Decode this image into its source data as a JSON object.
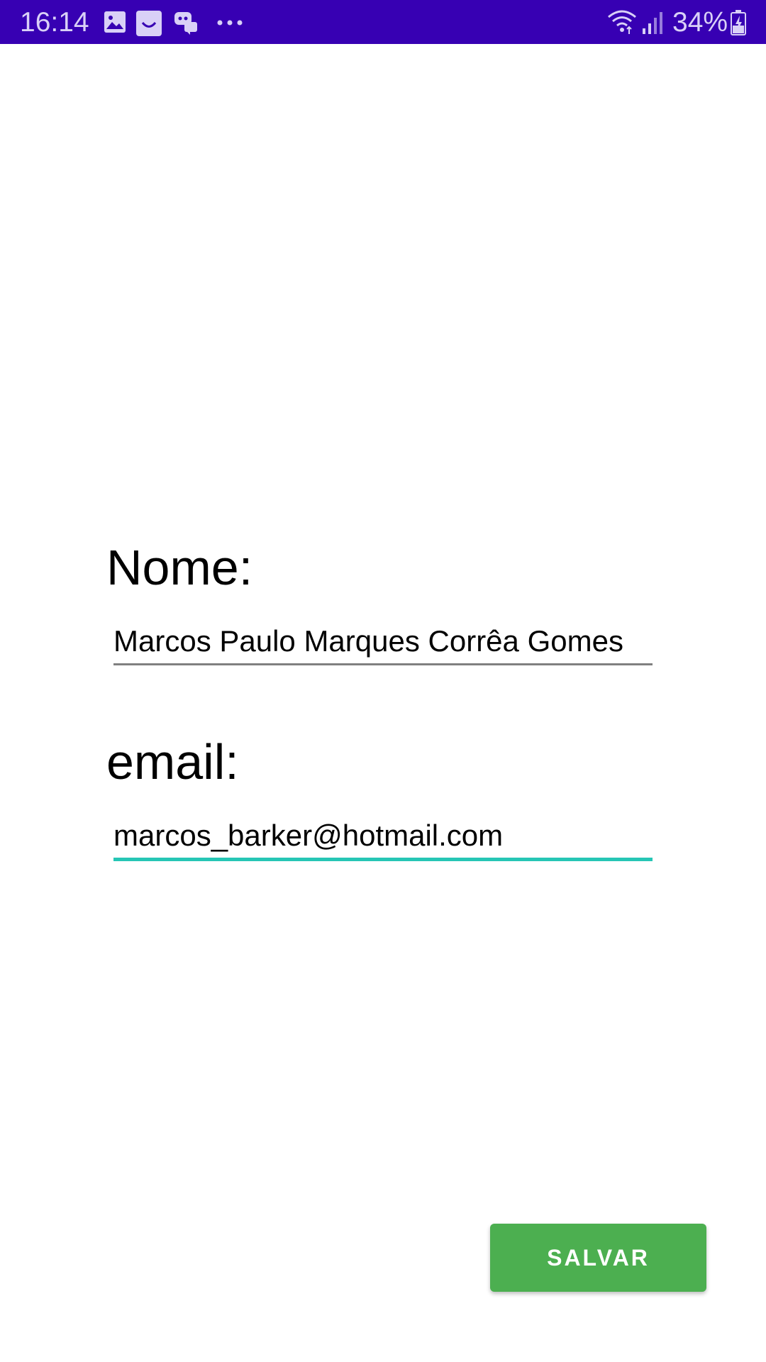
{
  "status_bar": {
    "time": "16:14",
    "battery_percent": "34%",
    "notification_icons": [
      "image-icon",
      "app-icon",
      "discord-icon",
      "more-icon"
    ],
    "system_icons": [
      "wifi-icon",
      "signal-icon",
      "battery-charging-icon"
    ],
    "background_color": "#3700b3"
  },
  "form": {
    "nome_label": "Nome:",
    "nome_value": "Marcos Paulo Marques Corrêa Gomes",
    "email_label": "email:",
    "email_value": "marcos_barker@hotmail.com",
    "focused_underline_color": "#26c6b5"
  },
  "actions": {
    "save_label": "SALVAR",
    "save_color": "#4caf50"
  }
}
